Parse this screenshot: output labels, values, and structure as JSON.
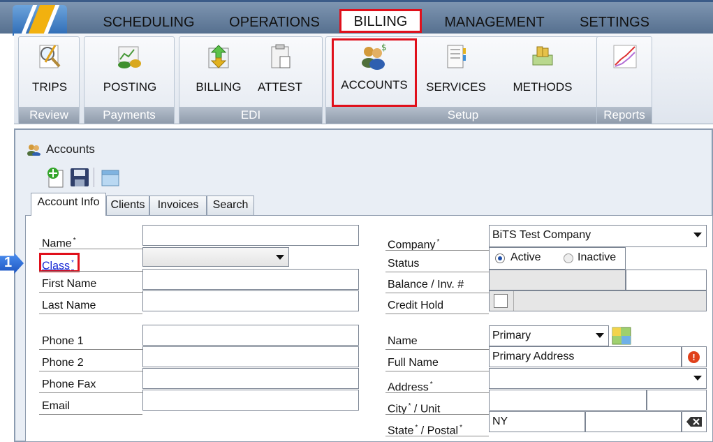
{
  "menu": {
    "items": [
      {
        "label": "SCHEDULING"
      },
      {
        "label": "OPERATIONS"
      },
      {
        "label": "BILLING"
      },
      {
        "label": "MANAGEMENT"
      },
      {
        "label": "SETTINGS"
      }
    ],
    "active": "BILLING"
  },
  "ribbon": {
    "groups": [
      {
        "label": "Review",
        "buttons": [
          {
            "label": "TRIPS",
            "icon": "trips-icon"
          }
        ]
      },
      {
        "label": "Payments",
        "buttons": [
          {
            "label": "POSTING",
            "icon": "posting-icon"
          }
        ]
      },
      {
        "label": "EDI",
        "buttons": [
          {
            "label": "BILLING",
            "icon": "billing-icon"
          },
          {
            "label": "ATTEST",
            "icon": "attest-icon"
          }
        ]
      },
      {
        "label": "Setup",
        "buttons": [
          {
            "label": "ACCOUNTS",
            "icon": "accounts-icon"
          },
          {
            "label": "SERVICES",
            "icon": "services-icon"
          },
          {
            "label": "METHODS",
            "icon": "methods-icon"
          }
        ]
      },
      {
        "label": "Reports",
        "buttons": [
          {
            "label": "",
            "icon": "reports-chart-icon"
          }
        ]
      }
    ],
    "selected_button": "ACCOUNTS"
  },
  "window": {
    "title": "Accounts"
  },
  "tabs": [
    {
      "label": "Account Info"
    },
    {
      "label": "Clients"
    },
    {
      "label": "Invoices"
    },
    {
      "label": "Search"
    }
  ],
  "form_left": {
    "name_label": "Name",
    "class_label": "Class",
    "first_name_label": "First Name",
    "last_name_label": "Last Name",
    "phone1_label": "Phone 1",
    "phone2_label": "Phone 2",
    "phone_fax_label": "Phone Fax",
    "email_label": "Email",
    "required_mark": "*"
  },
  "form_right": {
    "company_label": "Company",
    "company_value": "BiTS Test Company",
    "status_label": "Status",
    "status_active": "Active",
    "status_inactive": "Inactive",
    "status_selected": "Active",
    "balance_label": "Balance / Inv. #",
    "credit_hold_label": "Credit Hold",
    "name_label": "Name",
    "name_value": "Primary",
    "full_name_label": "Full Name",
    "full_name_value": "Primary Address",
    "address_label": "Address",
    "city_label": "City",
    "city_suffix": "/ Unit",
    "state_label": "State",
    "state_suffix": "/ Postal",
    "state_value": "NY"
  },
  "callout": {
    "number": "1"
  },
  "colors": {
    "highlight": "#e0101b",
    "link": "#1a2bd6",
    "callout": "#1e56c2"
  }
}
